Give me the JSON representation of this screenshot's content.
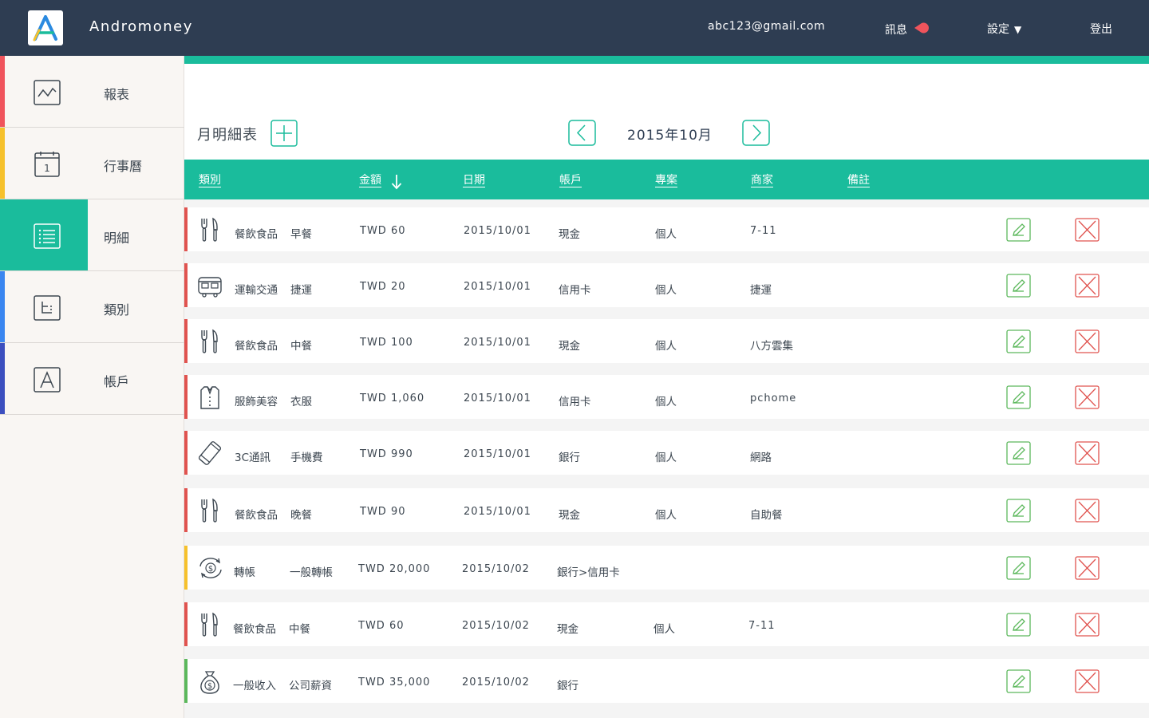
{
  "header": {
    "app_name": "Andromoney",
    "user_email": "abc123@gmail.com",
    "messages_label": "訊息",
    "settings_label": "設定",
    "settings_caret": "▼",
    "logout_label": "登出",
    "bg_color": "#2e3d52"
  },
  "sidebar": {
    "items": [
      {
        "label": "報表",
        "icon": "chart-icon",
        "stripe": "#f0545c"
      },
      {
        "label": "行事曆",
        "icon": "calendar-icon",
        "calendar_day": "1",
        "stripe": "#f6c12c"
      },
      {
        "label": "明細",
        "icon": "list-icon",
        "stripe": "#1abc9c",
        "active": true
      },
      {
        "label": "類別",
        "icon": "category-icon",
        "stripe": "#3a86f0"
      },
      {
        "label": "帳戶",
        "icon": "account-icon",
        "stripe": "#3c4fbf"
      }
    ]
  },
  "main": {
    "title": "月明細表",
    "month": "2015年10月",
    "accent": "#1abc9c"
  },
  "table": {
    "headers": {
      "category": "類別",
      "amount": "金額",
      "date": "日期",
      "account": "帳戶",
      "project": "專案",
      "merchant": "商家",
      "note": "備註"
    },
    "rows": [
      {
        "icon": "fork-knife-icon",
        "category": "餐飲食品",
        "sub": "早餐",
        "amount": "TWD 60",
        "date": "2015/10/01",
        "account": "現金",
        "project": "個人",
        "merchant": "7-11",
        "stripe": "#e0534f"
      },
      {
        "icon": "bus-icon",
        "category": "運輸交通",
        "sub": "捷運",
        "amount": "TWD 20",
        "date": "2015/10/01",
        "account": "信用卡",
        "project": "個人",
        "merchant": "捷運",
        "stripe": "#e0534f"
      },
      {
        "icon": "fork-knife-icon",
        "category": "餐飲食品",
        "sub": "中餐",
        "amount": "TWD 100",
        "date": "2015/10/01",
        "account": "現金",
        "project": "個人",
        "merchant": "八方雲集",
        "stripe": "#e0534f"
      },
      {
        "icon": "shirt-icon",
        "category": "服飾美容",
        "sub": "衣服",
        "amount": "TWD 1,060",
        "date": "2015/10/01",
        "account": "信用卡",
        "project": "個人",
        "merchant": "pchome",
        "stripe": "#e0534f"
      },
      {
        "icon": "phone-icon",
        "category": "3C通訊",
        "sub": "手機費",
        "amount": "TWD 990",
        "date": "2015/10/01",
        "account": "銀行",
        "project": "個人",
        "merchant": "網路",
        "stripe": "#e0534f"
      },
      {
        "icon": "fork-knife-icon",
        "category": "餐飲食品",
        "sub": "晚餐",
        "amount": "TWD 90",
        "date": "2015/10/01",
        "account": "現金",
        "project": "個人",
        "merchant": "自助餐",
        "stripe": "#e0534f"
      },
      {
        "icon": "transfer-icon",
        "category": "轉帳",
        "sub": "一般轉帳",
        "amount": "TWD 20,000",
        "date": "2015/10/02",
        "account": "銀行>信用卡",
        "project": "",
        "merchant": "",
        "stripe": "#f6c12c"
      },
      {
        "icon": "fork-knife-icon",
        "category": "餐飲食品",
        "sub": "中餐",
        "amount": "TWD 60",
        "date": "2015/10/02",
        "account": "現金",
        "project": "個人",
        "merchant": "7-11",
        "stripe": "#e0534f"
      },
      {
        "icon": "money-bag-icon",
        "category": "一般收入",
        "sub": "公司薪資",
        "amount": "TWD 35,000",
        "date": "2015/10/02",
        "account": "銀行",
        "project": "",
        "merchant": "",
        "stripe": "#5cb85c"
      }
    ]
  }
}
